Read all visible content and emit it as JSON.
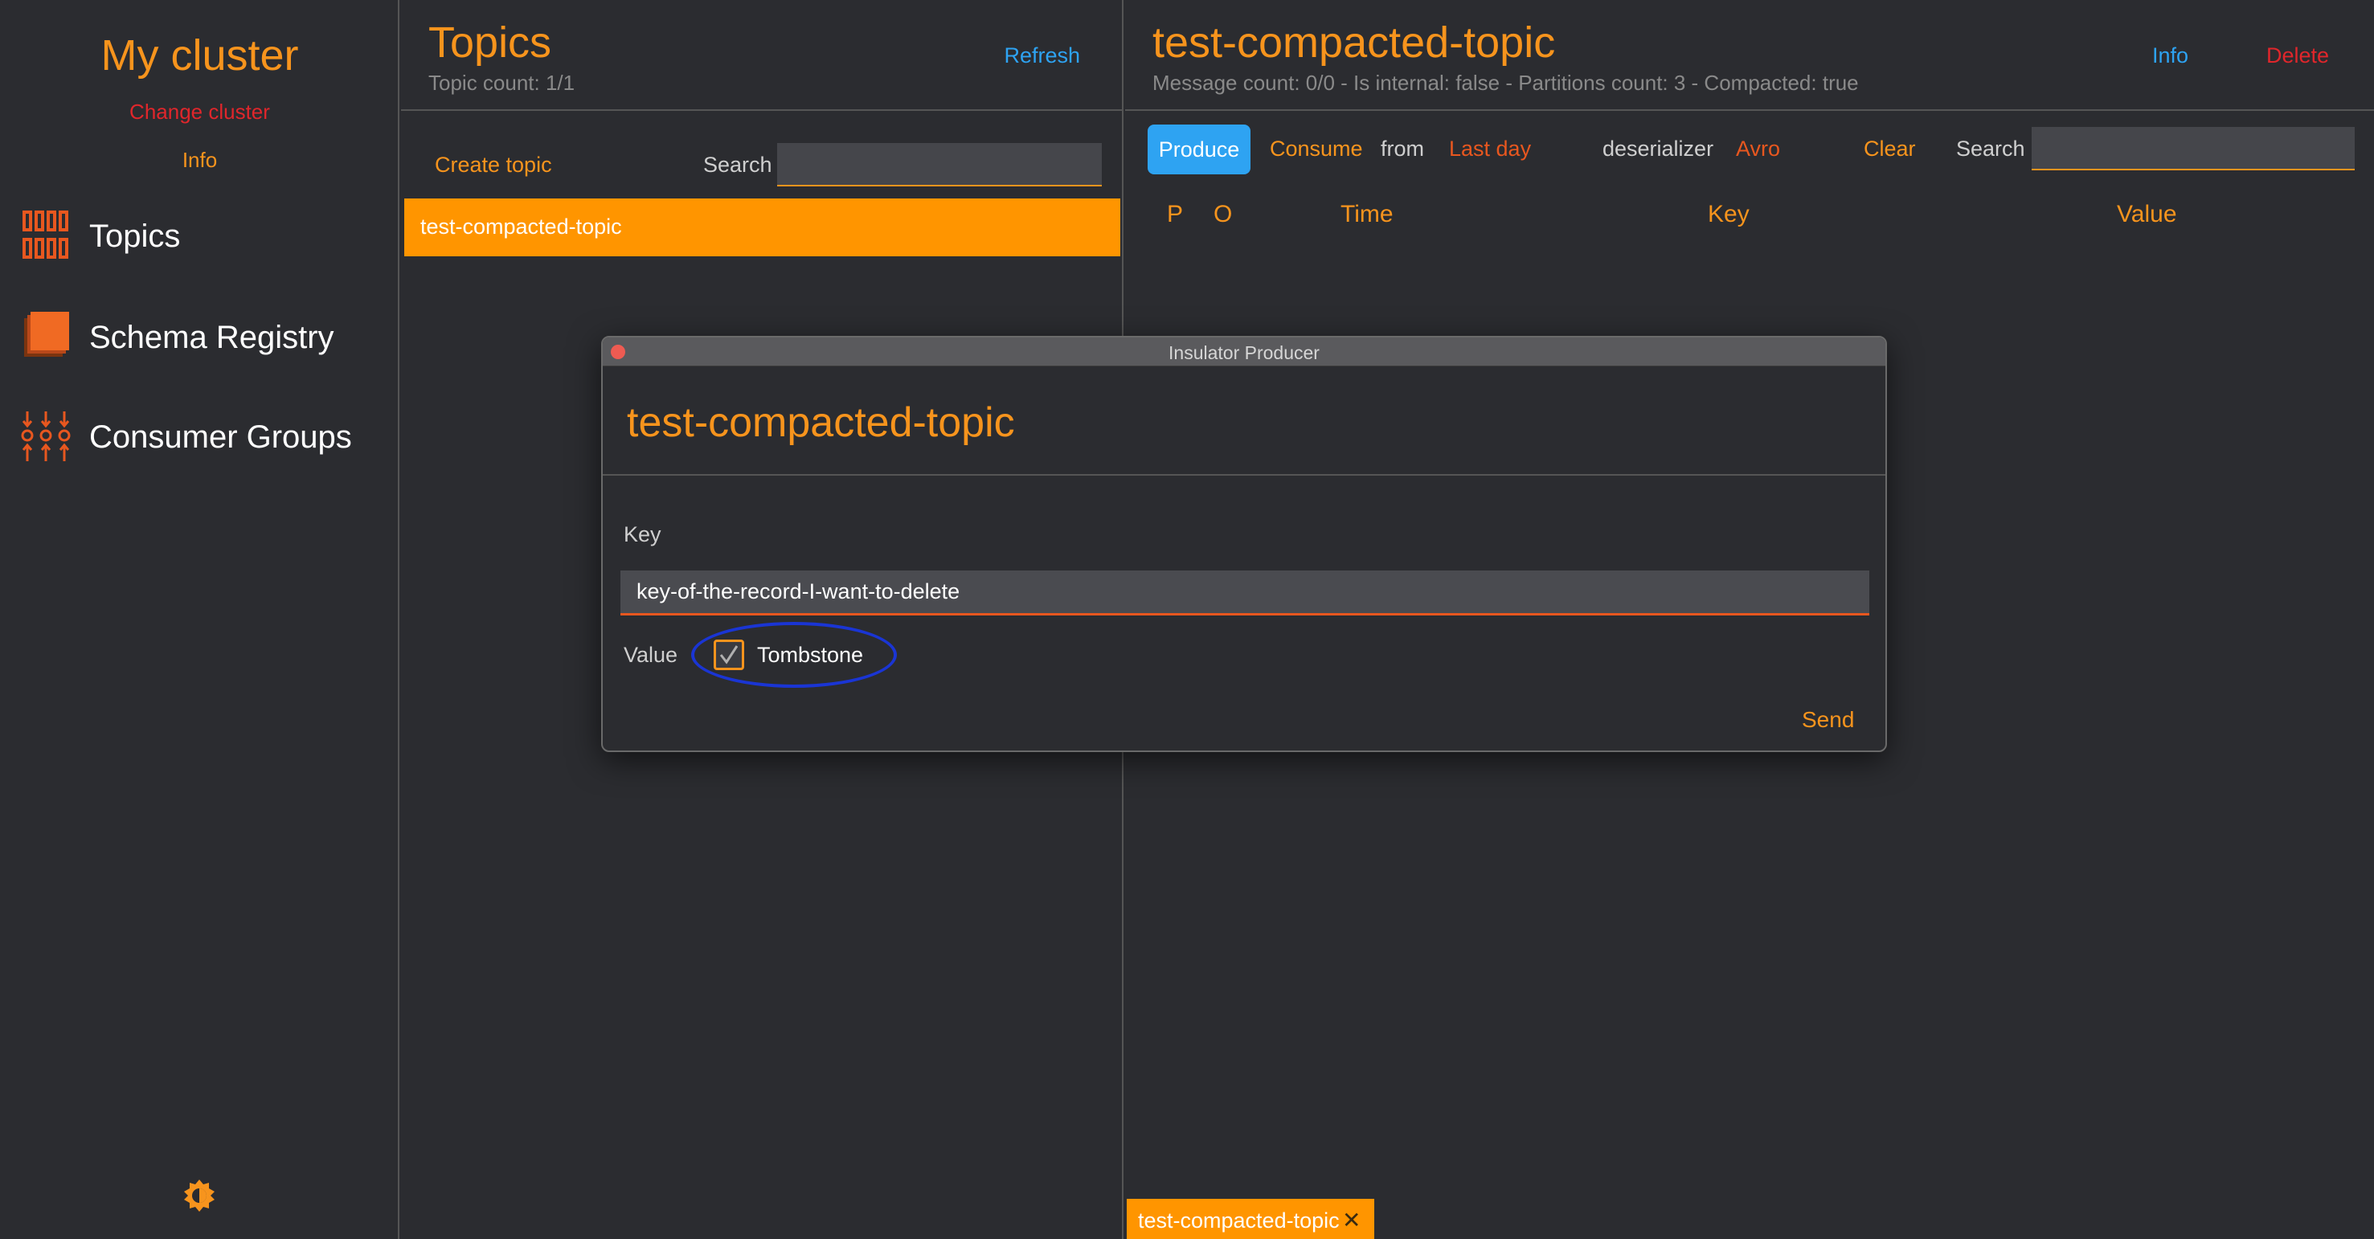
{
  "sidebar": {
    "cluster_name": "My cluster",
    "change_cluster": "Change cluster",
    "info": "Info",
    "nav": [
      {
        "label": "Topics",
        "icon": "topics-icon"
      },
      {
        "label": "Schema Registry",
        "icon": "schema-registry-icon"
      },
      {
        "label": "Consumer Groups",
        "icon": "consumer-groups-icon"
      }
    ],
    "theme_icon": "brightness-icon"
  },
  "topics_panel": {
    "title": "Topics",
    "count": "Topic count: 1/1",
    "refresh": "Refresh",
    "create_topic": "Create topic",
    "search_label": "Search",
    "search_value": "",
    "topics": [
      "test-compacted-topic"
    ]
  },
  "topic_detail": {
    "title": "test-compacted-topic",
    "meta": "Message count: 0/0 - Is internal: false - Partitions count: 3 - Compacted: true",
    "info": "Info",
    "delete": "Delete",
    "toolbar": {
      "produce": "Produce",
      "consume": "Consume",
      "from": "from",
      "from_value": "Last day",
      "deserializer": "deserializer",
      "deserializer_value": "Avro",
      "clear": "Clear",
      "search_label": "Search",
      "search_value": ""
    },
    "columns": [
      "P",
      "O",
      "Time",
      "Key",
      "Value"
    ]
  },
  "bottom_tab": {
    "label": "test-compacted-topic",
    "close": "✕"
  },
  "producer_dialog": {
    "window_title": "Insulator Producer",
    "topic": "test-compacted-topic",
    "key_label": "Key",
    "key_value": "key-of-the-record-I-want-to-delete",
    "value_label": "Value",
    "tombstone_label": "Tombstone",
    "tombstone_checked": true,
    "send": "Send"
  },
  "colors": {
    "background": "#2b2c30",
    "accent": "#f7941d",
    "link_blue": "#2ea3f2",
    "danger_red": "#e0262b",
    "highlight_annotation": "#1a35d4"
  }
}
